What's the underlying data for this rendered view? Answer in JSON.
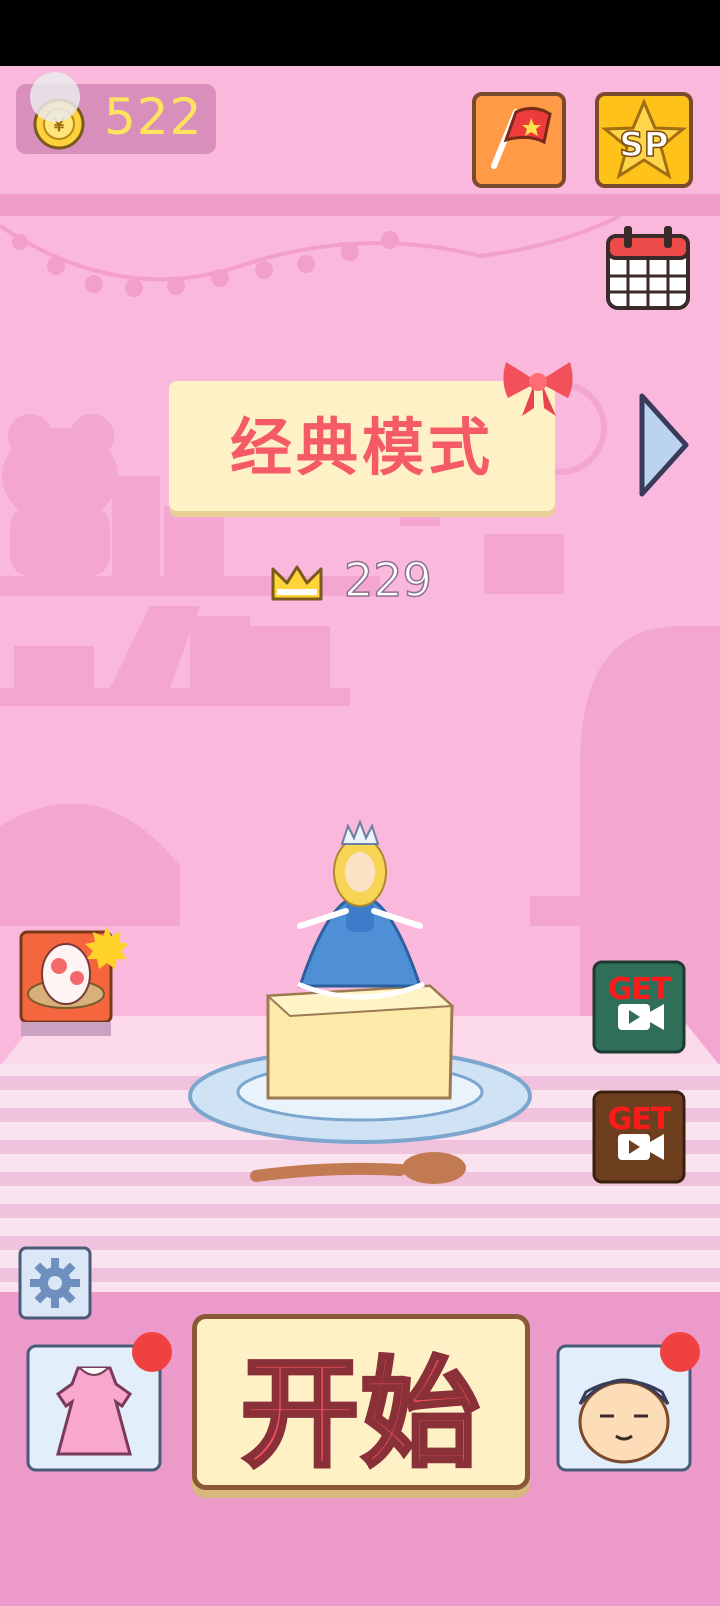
{
  "hud": {
    "coins": "522",
    "flag_button": "flag-icon",
    "sp_label": "SP",
    "calendar_button": "calendar-icon"
  },
  "mode": {
    "title": "经典模式",
    "best_score": "229"
  },
  "side_buttons": {
    "egg": "egg-nest-icon",
    "get_1": "GET",
    "get_2": "GET"
  },
  "bottom": {
    "start_label": "开始",
    "outfit": "dress-icon",
    "chef": "chef-icon",
    "settings": "gear-icon"
  },
  "colors": {
    "background": "#f9b8dc",
    "coin_text": "#ffe35e",
    "title_red": "#f45b67",
    "banner": "#fff1c6"
  }
}
